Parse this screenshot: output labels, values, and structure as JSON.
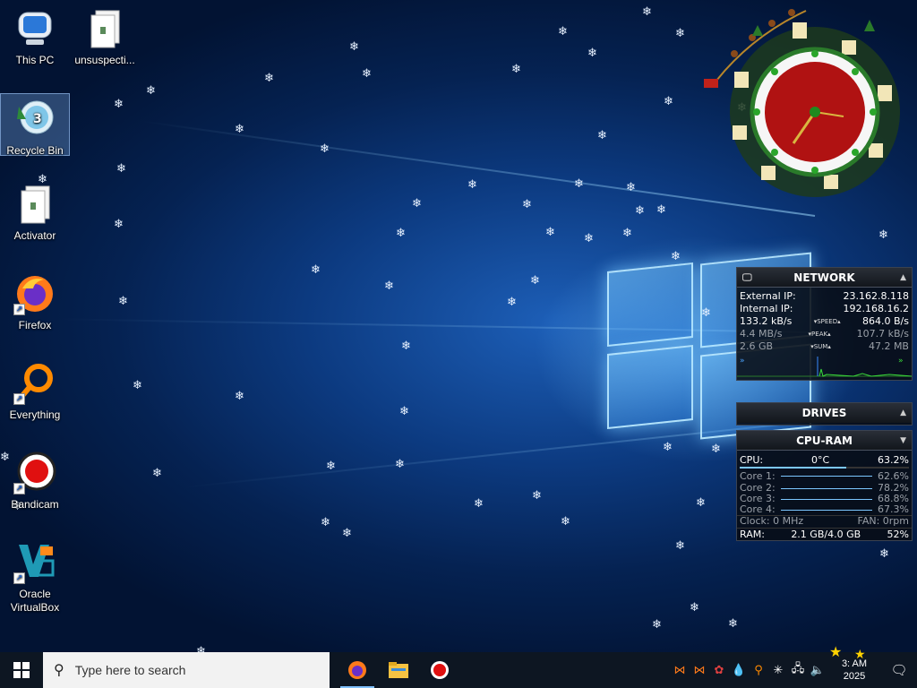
{
  "desktop": {
    "icons": [
      {
        "label": "This PC",
        "icon": "computer-icon"
      },
      {
        "label": "unsuspecti...",
        "icon": "file-icon"
      },
      {
        "label": "Recycle Bin",
        "icon": "recycle-bin-icon"
      },
      {
        "label": "Activator",
        "icon": "file-icon"
      },
      {
        "label": "Firefox",
        "icon": "firefox-icon"
      },
      {
        "label": "Everything",
        "icon": "search-tool-icon"
      },
      {
        "label": "Bandicam",
        "icon": "record-icon"
      },
      {
        "label": "Oracle\nVirtualBox",
        "icon": "virtualbox-icon"
      }
    ]
  },
  "network": {
    "title": "NETWORK",
    "external_ip_label": "External IP:",
    "external_ip": "23.162.8.118",
    "internal_ip_label": "Internal IP:",
    "internal_ip": "192.168.16.2",
    "speed_down": "133.2 kB/s",
    "speed_label": "SPEED",
    "speed_up": "864.0 B/s",
    "peak_down": "4.4 MB/s",
    "peak_label": "PEAK",
    "peak_up": "107.7 kB/s",
    "sum_down": "2.6 GB",
    "sum_label": "SUM",
    "sum_up": "47.2 MB"
  },
  "drives": {
    "title": "DRIVES"
  },
  "cpu_ram": {
    "title": "CPU-RAM",
    "cpu_label": "CPU:",
    "cpu_temp": "0°C",
    "cpu_percent": "63.2%",
    "cores": [
      {
        "label": "Core 1:",
        "value": "62.6%"
      },
      {
        "label": "Core 2:",
        "value": "78.2%"
      },
      {
        "label": "Core 3:",
        "value": "68.8%"
      },
      {
        "label": "Core 4:",
        "value": "67.3%"
      }
    ],
    "clock_label": "Clock: 0 MHz",
    "fan_label": "FAN: 0rpm",
    "ram_label": "RAM:",
    "ram_usage": "2.1 GB/4.0 GB",
    "ram_percent": "52%"
  },
  "taskbar": {
    "search_placeholder": "Type here to search",
    "clock_time": "3:  AM",
    "clock_date": "2025"
  },
  "colors": {
    "accent": "#7fc0ff",
    "gadget_bg": "#080c14",
    "taskbar_bg": "#0d1622"
  }
}
